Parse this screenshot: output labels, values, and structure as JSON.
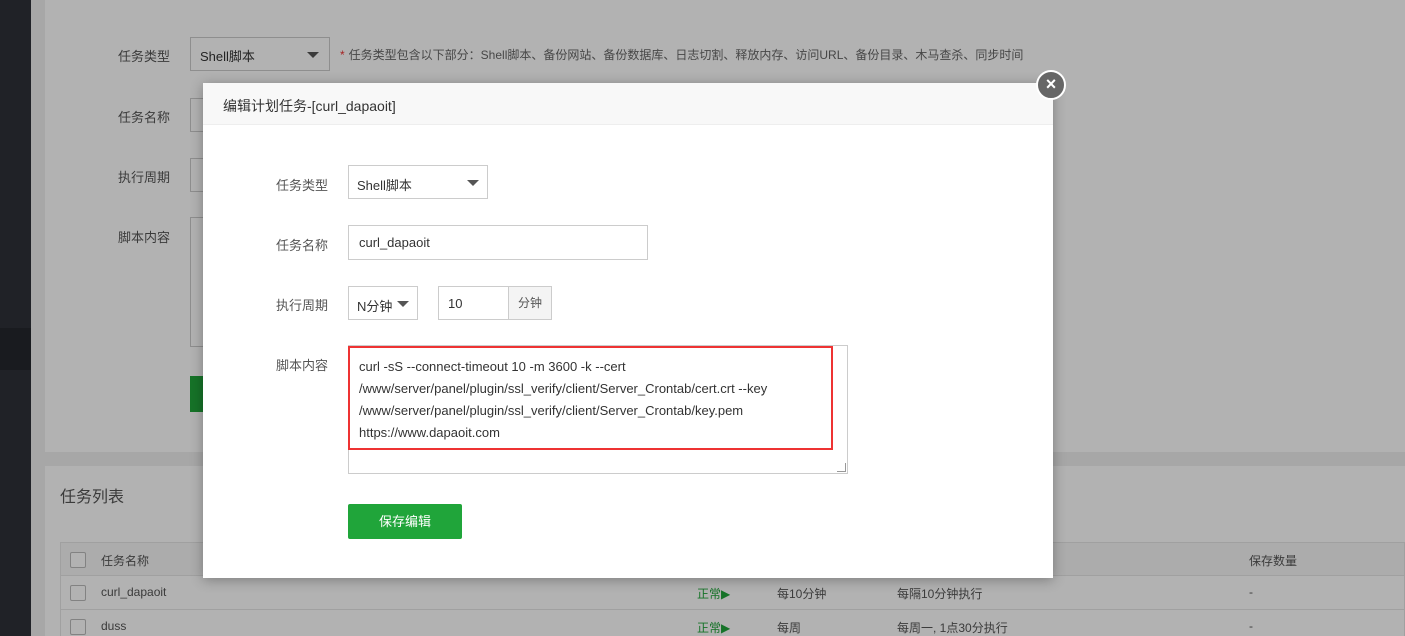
{
  "background_form": {
    "labels": [
      "任务类型",
      "任务名称",
      "执行周期",
      "脚本内容"
    ],
    "task_type_value": "Shell脚本",
    "hint": "任务类型包含以下部分：Shell脚本、备份网站、备份数据库、日志切割、释放内存、访问URL、备份目录、木马查杀、同步时间"
  },
  "task_list": {
    "title": "任务列表",
    "columns": {
      "name": "任务名称",
      "keep_count": "保存数量"
    },
    "rows": [
      {
        "name": "curl_dapaoit",
        "status": "正常▶",
        "period": "每10分钟",
        "exec": "每隔10分钟执行",
        "keep": "-"
      },
      {
        "name": "duss",
        "status": "正常▶",
        "period": "每周",
        "exec": "每周一, 1点30分执行",
        "keep": "-"
      }
    ]
  },
  "modal": {
    "title": "编辑计划任务-[curl_dapaoit]",
    "close_glyph": "×",
    "labels": {
      "task_type": "任务类型",
      "task_name": "任务名称",
      "period": "执行周期",
      "script": "脚本内容"
    },
    "task_type_value": "Shell脚本",
    "task_name_value": "curl_dapaoit",
    "period_value": "N分钟",
    "minutes_value": "10",
    "minutes_unit": "分钟",
    "script_lines": [
      "curl -sS --connect-timeout 10 -m 3600  -k --cert",
      "/www/server/panel/plugin/ssl_verify/client/Server_Crontab/cert.crt --key",
      "/www/server/panel/plugin/ssl_verify/client/Server_Crontab/key.pem",
      "https://www.dapaoit.com"
    ],
    "save_label": "保存编辑"
  },
  "colors": {
    "accent_green": "#20a53a",
    "highlight_red": "#e33333",
    "sidebar": "#2f3238"
  }
}
